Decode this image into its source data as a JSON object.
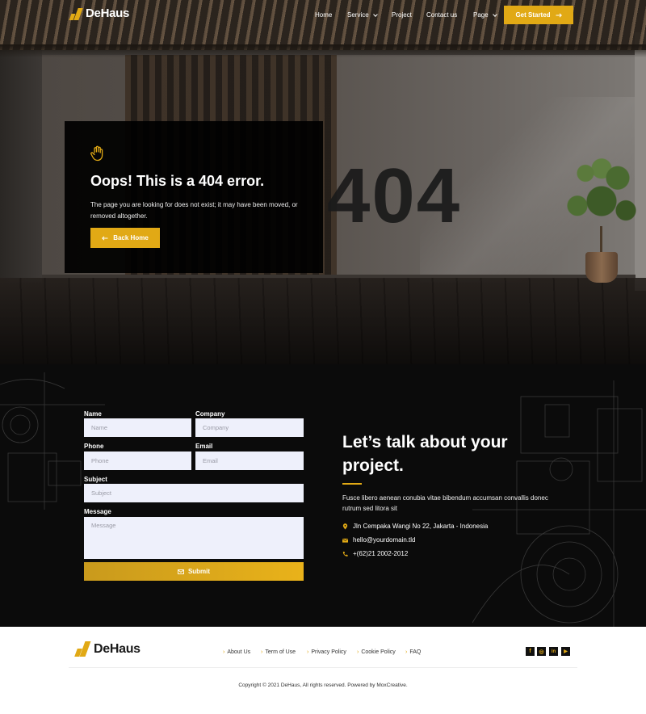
{
  "brand": {
    "name": "DeHaus",
    "accent": "#e1a915"
  },
  "nav": {
    "items": [
      {
        "label": "Home",
        "dropdown": false
      },
      {
        "label": "Service",
        "dropdown": true
      },
      {
        "label": "Project",
        "dropdown": false
      },
      {
        "label": "Contact us",
        "dropdown": false
      },
      {
        "label": "Page",
        "dropdown": true
      }
    ],
    "cta_label": "Get Started"
  },
  "hero": {
    "big_code": "404",
    "title": "Oops! This is a 404 error.",
    "text": "The page you are looking for does not exist; it may have been moved, or removed altogether.",
    "back_label": "Back Home",
    "icon": "hand-icon"
  },
  "form": {
    "name": {
      "label": "Name",
      "placeholder": "Name"
    },
    "company": {
      "label": "Company",
      "placeholder": "Company"
    },
    "phone": {
      "label": "Phone",
      "placeholder": "Phone"
    },
    "email": {
      "label": "Email",
      "placeholder": "Email"
    },
    "subject": {
      "label": "Subject",
      "placeholder": "Subject"
    },
    "message": {
      "label": "Message",
      "placeholder": "Message"
    },
    "submit_label": "Submit"
  },
  "contact": {
    "title": "Let’s talk about your project.",
    "text": "Fusce libero aenean conubia vitae bibendum accumsan convallis donec rutrum sed litora sit",
    "address": "Jln Cempaka Wangi No 22, Jakarta - Indonesia",
    "email": "hello@yourdomain.tld",
    "phone": "+(62)21 2002-2012"
  },
  "footer": {
    "links": [
      "About Us",
      "Term of Use",
      "Privacy Policy",
      "Cookie Policy",
      "FAQ"
    ],
    "social": [
      {
        "icon": "facebook-icon",
        "glyph": "f"
      },
      {
        "icon": "instagram-icon",
        "glyph": "◎"
      },
      {
        "icon": "linkedin-icon",
        "glyph": "in"
      },
      {
        "icon": "youtube-icon",
        "glyph": "▶"
      }
    ],
    "copyright": "Copyright © 2021 DeHaus, All rights reserved. Powered by MoxCreative."
  }
}
